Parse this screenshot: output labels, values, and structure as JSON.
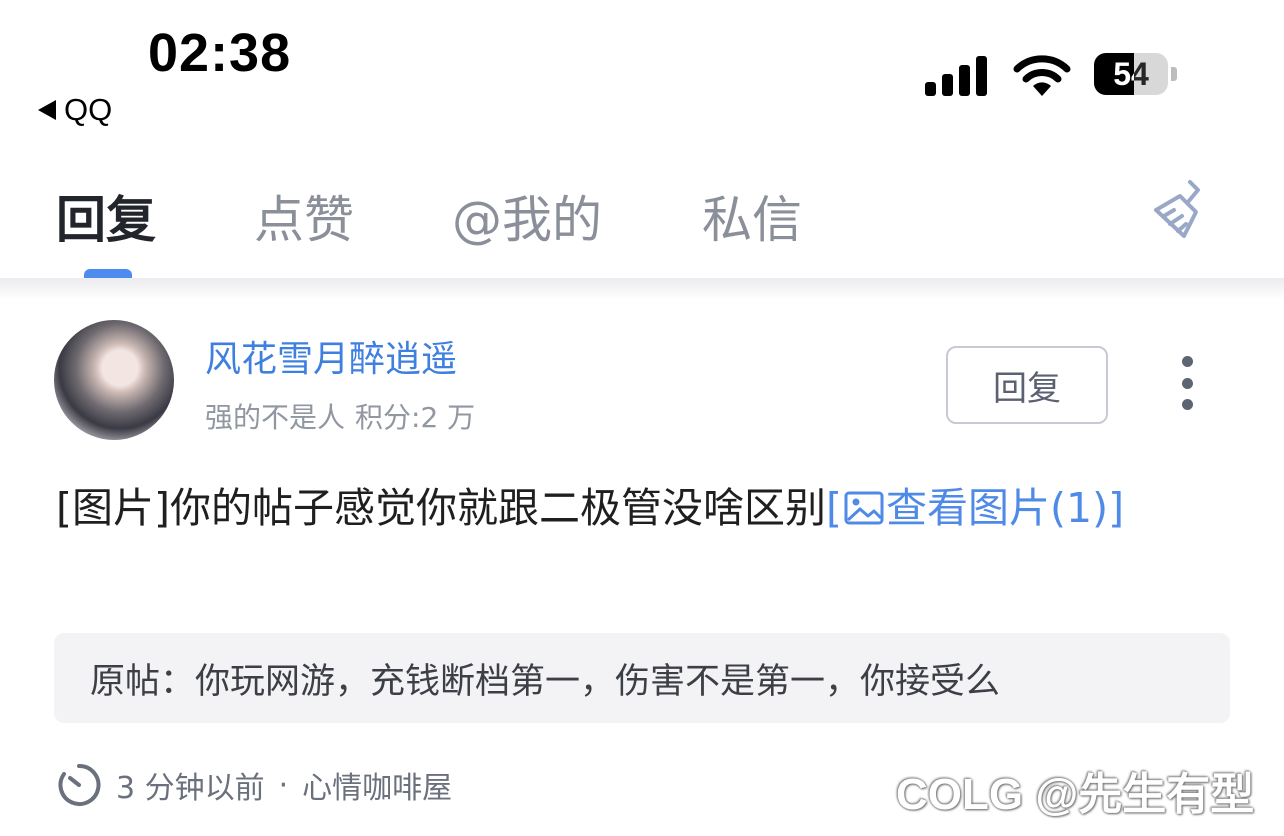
{
  "status_bar": {
    "time": "02:38",
    "back_app": "QQ",
    "battery": "54"
  },
  "tabs": [
    {
      "label": "回复",
      "active": true
    },
    {
      "label": "点赞",
      "active": false
    },
    {
      "label": "@我的",
      "active": false
    },
    {
      "label": "私信",
      "active": false
    }
  ],
  "message": {
    "username": "风花雪月醉逍遥",
    "user_title": "强的不是人",
    "user_score": "积分:2 万",
    "reply_button": "回复",
    "content": "[图片]你的帖子感觉你就跟二极管没啥区别",
    "view_image_prefix": "[",
    "view_image_label": "查看图片(1)]",
    "original_post": "原帖：你玩网游，充钱断档第一，伤害不是第一，你接受么",
    "time_ago": "3 分钟以前",
    "separator": "·",
    "forum": "心情咖啡屋"
  },
  "watermark": "COLG @先生有型",
  "colors": {
    "accent": "#4d8bf0",
    "username": "#3e7fe0",
    "link": "#4f8be6"
  }
}
